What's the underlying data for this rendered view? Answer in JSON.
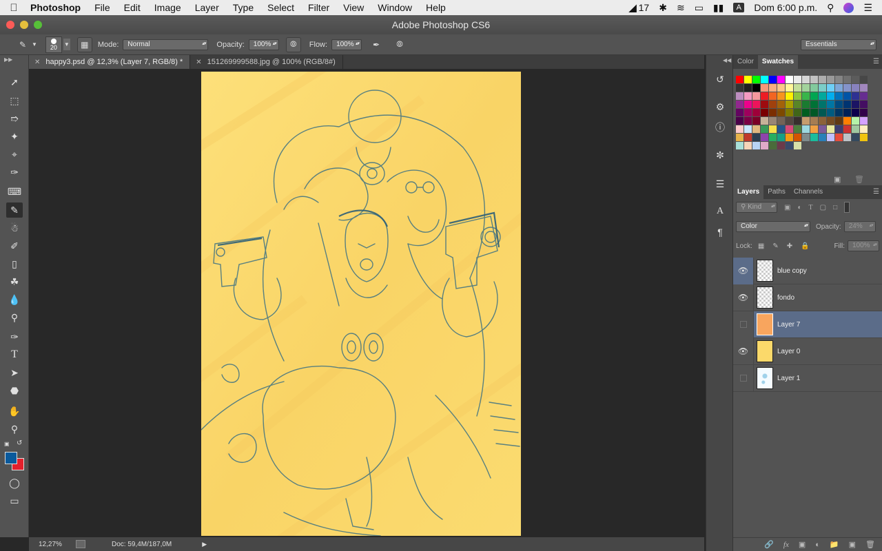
{
  "menubar": {
    "app_name": "Photoshop",
    "items": [
      "File",
      "Edit",
      "Image",
      "Layer",
      "Type",
      "Select",
      "Filter",
      "View",
      "Window",
      "Help"
    ],
    "status_number": "17",
    "user_initial": "A",
    "clock": "Dom 6:00 p.m."
  },
  "window": {
    "title": "Adobe Photoshop CS6"
  },
  "options": {
    "brush_size": "20",
    "mode_label": "Mode:",
    "mode_value": "Normal",
    "opacity_label": "Opacity:",
    "opacity_value": "100%",
    "flow_label": "Flow:",
    "flow_value": "100%",
    "workspace": "Essentials"
  },
  "tabs": [
    {
      "title": "happy3.psd @ 12,3% (Layer 7, RGB/8) *"
    },
    {
      "title": "151269999588.jpg @ 100% (RGB/8#)"
    }
  ],
  "status": {
    "zoom": "12,27%",
    "doc": "Doc: 59,4M/187,0M"
  },
  "swatch_panel": {
    "tabs": [
      "Color",
      "Swatches"
    ],
    "colors": [
      "#ff0000",
      "#ffff00",
      "#00ff00",
      "#00ffff",
      "#0000ff",
      "#ff00ff",
      "#ffffff",
      "#ebebeb",
      "#d6d6d6",
      "#c2c2c2",
      "#adadad",
      "#999999",
      "#858585",
      "#707070",
      "#5c5c5c",
      "#474747",
      "#333333",
      "#1f1f1f",
      "#000000",
      "#f7977a",
      "#f9ad81",
      "#fdc68a",
      "#fff79a",
      "#c4df9b",
      "#a2d39c",
      "#82ca9d",
      "#7bcdc8",
      "#6ecff6",
      "#7ea7d8",
      "#8493ca",
      "#8882be",
      "#a187be",
      "#bc8dbf",
      "#f49ac2",
      "#f6989d",
      "#ed1c24",
      "#f26522",
      "#f7941d",
      "#fff200",
      "#8dc63f",
      "#39b54a",
      "#00a651",
      "#00a99d",
      "#00aeef",
      "#0072bc",
      "#0054a6",
      "#2e3192",
      "#662d91",
      "#92278f",
      "#ec008c",
      "#ed145b",
      "#9e0b0f",
      "#a0410d",
      "#a36209",
      "#aba000",
      "#598527",
      "#1a7b30",
      "#007236",
      "#00746b",
      "#0076a3",
      "#004b80",
      "#003471",
      "#1b1464",
      "#440e62",
      "#630460",
      "#9e005d",
      "#9e0039",
      "#790000",
      "#7b2e00",
      "#7d4900",
      "#827b00",
      "#406618",
      "#005e20",
      "#005826",
      "#005952",
      "#005b7f",
      "#003663",
      "#002157",
      "#0d004c",
      "#32004b",
      "#4b0049",
      "#7b0046",
      "#7a0026",
      "#c7b299",
      "#998675",
      "#736357",
      "#534741",
      "#37302d",
      "#c69c6d",
      "#a67c52",
      "#8c6239",
      "#754c24",
      "#603913",
      "#ff7f00",
      "#b5f2a8",
      "#d4a1ff",
      "#ffcccc",
      "#c8e6ff",
      "#e1b87f",
      "#3a9a5a",
      "#f6e04b",
      "#25558a",
      "#d64a79",
      "#4c7e3c",
      "#9cd8e0",
      "#f0a043",
      "#7d5a99",
      "#e8e8a0",
      "#3e3e70",
      "#cc3333",
      "#a0c8a0",
      "#ffeec0",
      "#e7b24a",
      "#c0392b",
      "#2c3e50",
      "#8e44ad",
      "#27ae60",
      "#16a085",
      "#f39c12",
      "#d35400",
      "#7f8c8d",
      "#1abc9c",
      "#2980b9",
      "#c0c0ff",
      "#e74c3c",
      "#bdc3c7",
      "#34495e",
      "#f1c40f",
      "#a9e0d8",
      "#f5d4b8",
      "#b8d4f5",
      "#e0a9c8",
      "#4a6b3a",
      "#6b3a4a",
      "#3a4a6b",
      "#d8e0a9"
    ]
  },
  "layers_panel": {
    "tabs": [
      "Layers",
      "Paths",
      "Channels"
    ],
    "filter_label": "Kind",
    "blend_mode": "Color",
    "opacity_label": "Opacity:",
    "opacity_value": "24%",
    "lock_label": "Lock:",
    "fill_label": "Fill:",
    "fill_value": "100%",
    "layers": [
      {
        "name": "blue copy",
        "visible": true,
        "thumb": "checker"
      },
      {
        "name": "fondo",
        "visible": true,
        "thumb": "checker"
      },
      {
        "name": "Layer 7",
        "visible": false,
        "thumb": "#f8a55e"
      },
      {
        "name": "Layer 0",
        "visible": true,
        "thumb": "#fbd96a"
      },
      {
        "name": "Layer 1",
        "visible": false,
        "thumb": "checker-sketch"
      }
    ]
  },
  "colors": {
    "foreground": "#0a5a9c",
    "background": "#e4202c",
    "canvas_fill": "#fbd96a",
    "sketch_line": "#2d6e80",
    "selected_layer": "#5b6c89"
  }
}
